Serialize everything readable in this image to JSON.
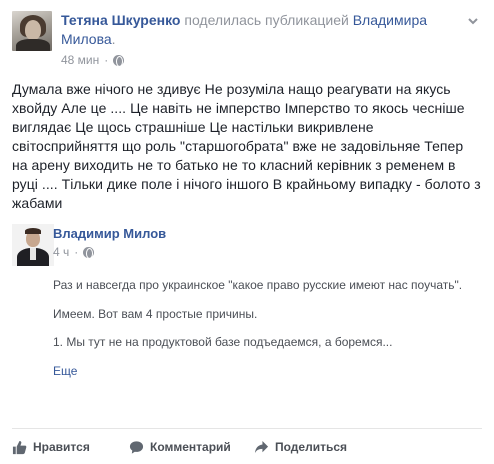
{
  "post": {
    "author": "Тетяна Шкуренко",
    "action_text": " поделилась публикацией ",
    "shared_from": "Владимира Милова",
    "period": ".",
    "time": "48 мин",
    "text": "Думала вже нічого не здивує Не розуміла нащо реагувати на якусь хвойду Але це .... Це навіть не імперство Імперство то якось чесніше виглядає Це щось страшніше Це настільки викривлене світосприйняття що роль \"старшогобрата\" вже не задовільняе Тепер на арену виходить не то батько не то класний керівник з ременем в руці .... Тільки дике поле і нічого іншого В крайньому випадку - болото з жабами"
  },
  "shared": {
    "name": "Владимир Милов",
    "time": "4 ч",
    "line1": "Раз и навсегда про украинское \"какое право русские имеют нас поучать\".",
    "line2": "Имеем. Вот вам 4 простые причины.",
    "line3": "1. Мы тут не на продуктовой базе подъедаемся, а боремся...",
    "more": "Еще"
  },
  "actions": {
    "like": "Нравится",
    "comment": "Комментарий",
    "share": "Поделиться"
  },
  "colors": {
    "link": "#365899",
    "meta": "#90949c",
    "text": "#1d2129",
    "action": "#4b4f56"
  },
  "icons": [
    "globe-icon",
    "chevron-down-icon",
    "like-icon",
    "comment-icon",
    "share-icon"
  ]
}
